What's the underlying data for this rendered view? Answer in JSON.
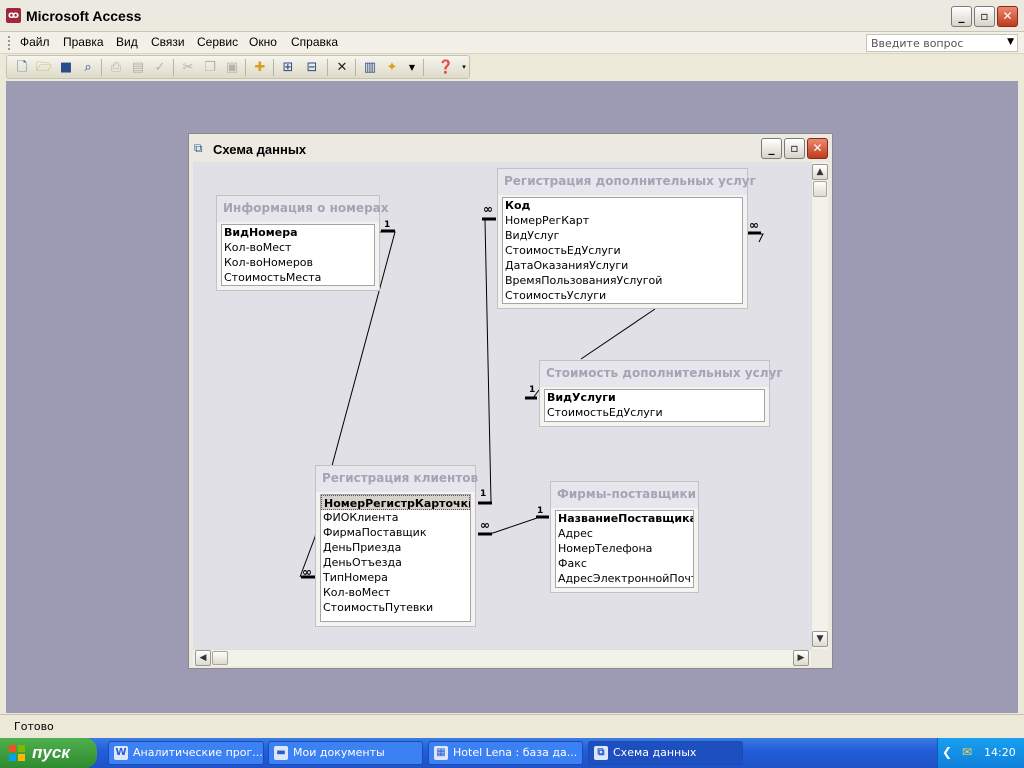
{
  "app": {
    "title": "Microsoft Access",
    "icon": "access-key-icon"
  },
  "menu": {
    "items": [
      "Файл",
      "Правка",
      "Вид",
      "Связи",
      "Сервис",
      "Окно",
      "Справка"
    ],
    "ask_placeholder": "Введите вопрос"
  },
  "toolbar": {
    "icons": [
      "new-icon",
      "open-icon",
      "save-icon",
      "search-icon",
      "print-icon",
      "preview-icon",
      "spelling-icon",
      "cut-icon",
      "copy-icon",
      "paste-icon",
      "show-table-icon",
      "direct-relations-icon",
      "all-relations-icon",
      "delete-icon",
      "new-object-icon",
      "database-window-icon",
      "help-icon"
    ]
  },
  "child_window": {
    "title": "Схема данных",
    "icon": "relationships-icon"
  },
  "tables": [
    {
      "id": "rooms",
      "title": "Информация о номерах",
      "fields": [
        {
          "name": "ВидНомера",
          "pk": true
        },
        {
          "name": "Кол-воМест",
          "pk": false
        },
        {
          "name": "Кол-воНомеров",
          "pk": false
        },
        {
          "name": "СтоимостьМеста",
          "pk": false
        }
      ]
    },
    {
      "id": "services",
      "title": "Регистрация дополнительных услуг",
      "fields": [
        {
          "name": "Код",
          "pk": true
        },
        {
          "name": "НомерРегКарт",
          "pk": false
        },
        {
          "name": "ВидУслуг",
          "pk": false
        },
        {
          "name": "СтоимостьЕдУслуги",
          "pk": false
        },
        {
          "name": "ДатаОказанияУслуги",
          "pk": false
        },
        {
          "name": "ВремяПользованияУслугой",
          "pk": false
        },
        {
          "name": "СтоимостьУслуги",
          "pk": false
        }
      ]
    },
    {
      "id": "service_cost",
      "title": "Стоимость дополнительных услуг",
      "fields": [
        {
          "name": "ВидУслуги",
          "pk": true
        },
        {
          "name": "СтоимостьЕдУслуги",
          "pk": false
        }
      ]
    },
    {
      "id": "clients",
      "title": "Регистрация клиентов",
      "fields": [
        {
          "name": "НомерРегистрКарточки",
          "pk": true,
          "selected": true
        },
        {
          "name": "ФИОКлиента",
          "pk": false
        },
        {
          "name": "ФирмаПоставщик",
          "pk": false
        },
        {
          "name": "ДеньПриезда",
          "pk": false
        },
        {
          "name": "ДеньОтъезда",
          "pk": false
        },
        {
          "name": "ТипНомера",
          "pk": false
        },
        {
          "name": "Кол-воМест",
          "pk": false
        },
        {
          "name": "СтоимостьПутевки",
          "pk": false
        }
      ]
    },
    {
      "id": "suppliers",
      "title": "Фирмы-поставщики",
      "fields": [
        {
          "name": "НазваниеПоставщика",
          "pk": true
        },
        {
          "name": "Адрес",
          "pk": false
        },
        {
          "name": "НомерТелефона",
          "pk": false
        },
        {
          "name": "Факс",
          "pk": false
        },
        {
          "name": "АдресЭлектроннойПочты",
          "pk": false
        }
      ]
    }
  ],
  "relations": {
    "one": "1",
    "many": "∞"
  },
  "status": {
    "text": "Готово"
  },
  "taskbar": {
    "start_label": "пуск",
    "tasks": [
      {
        "label": "Аналитические прог...",
        "icon": "word-icon"
      },
      {
        "label": "Мои документы",
        "icon": "folder-icon"
      },
      {
        "label": "Hotel Lena : база да...",
        "icon": "access-db-icon"
      },
      {
        "label": "Схема данных",
        "icon": "relationships-icon"
      }
    ],
    "clock": "14:20"
  }
}
